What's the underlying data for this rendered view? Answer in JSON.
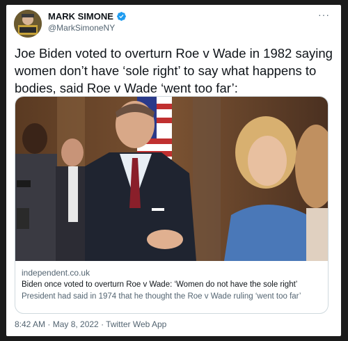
{
  "author": {
    "display_name": "MARK SIMONE",
    "handle": "@MarkSimoneNY",
    "verified": true
  },
  "tweet": {
    "text": "Joe Biden voted to overturn Roe v Wade in 1982 saying women don’t have ‘sole right’ to say what happens to bodies, said Roe v Wade ‘went too far’:"
  },
  "link_card": {
    "domain": "independent.co.uk",
    "title": "Biden once voted to overturn Roe v Wade: ‘Women do not have the sole right’",
    "description": "President had said in 1974 that he thought the Roe v Wade ruling ‘went too far’"
  },
  "footer": {
    "timestamp": "8:42 AM · May 8, 2022 · Twitter Web App"
  },
  "icons": {
    "verified": "verified-badge-icon",
    "more": "more-options-icon"
  },
  "colors": {
    "verified_blue": "#1d9bf0",
    "secondary_text": "#536471",
    "primary_text": "#0f1419",
    "card_border": "#cfd9de"
  }
}
